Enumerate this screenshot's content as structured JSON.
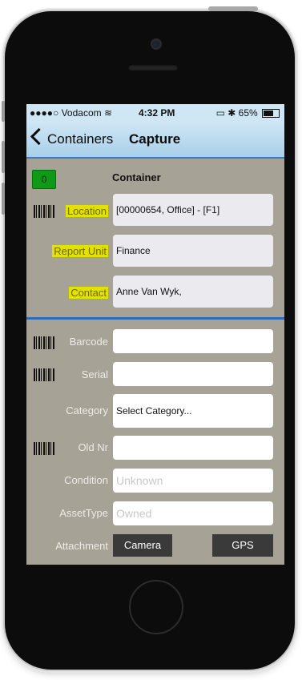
{
  "status_bar": {
    "carrier": "●●●●○ Vodacom ≋",
    "time": "4:32 PM",
    "battery_text": "▭ ✱ 65%"
  },
  "nav": {
    "back_label": "Containers",
    "title": "Capture"
  },
  "container": {
    "badge_count": "0",
    "heading": "Container"
  },
  "fields": {
    "location": {
      "label": "Location",
      "value": "[00000654, Office] - [F1]"
    },
    "report_unit": {
      "label": "Report Unit",
      "value": "Finance"
    },
    "contact": {
      "label": "Contact",
      "value": "Anne Van Wyk,"
    },
    "barcode": {
      "label": "Barcode",
      "value": ""
    },
    "serial": {
      "label": "Serial",
      "value": ""
    },
    "category": {
      "label": "Category",
      "value": "Select Category..."
    },
    "old_nr": {
      "label": "Old Nr",
      "value": ""
    },
    "condition": {
      "label": "Condition",
      "placeholder": "Unknown"
    },
    "asset_type": {
      "label": "AssetType",
      "placeholder": "Owned"
    },
    "attachment": {
      "label": "Attachment"
    }
  },
  "buttons": {
    "camera": "Camera",
    "gps": "GPS"
  },
  "colors": {
    "nav_accent": "#2f6db2",
    "highlight": "#e4e000",
    "badge_green": "#0e9a17",
    "form_background": "#a6a295"
  }
}
